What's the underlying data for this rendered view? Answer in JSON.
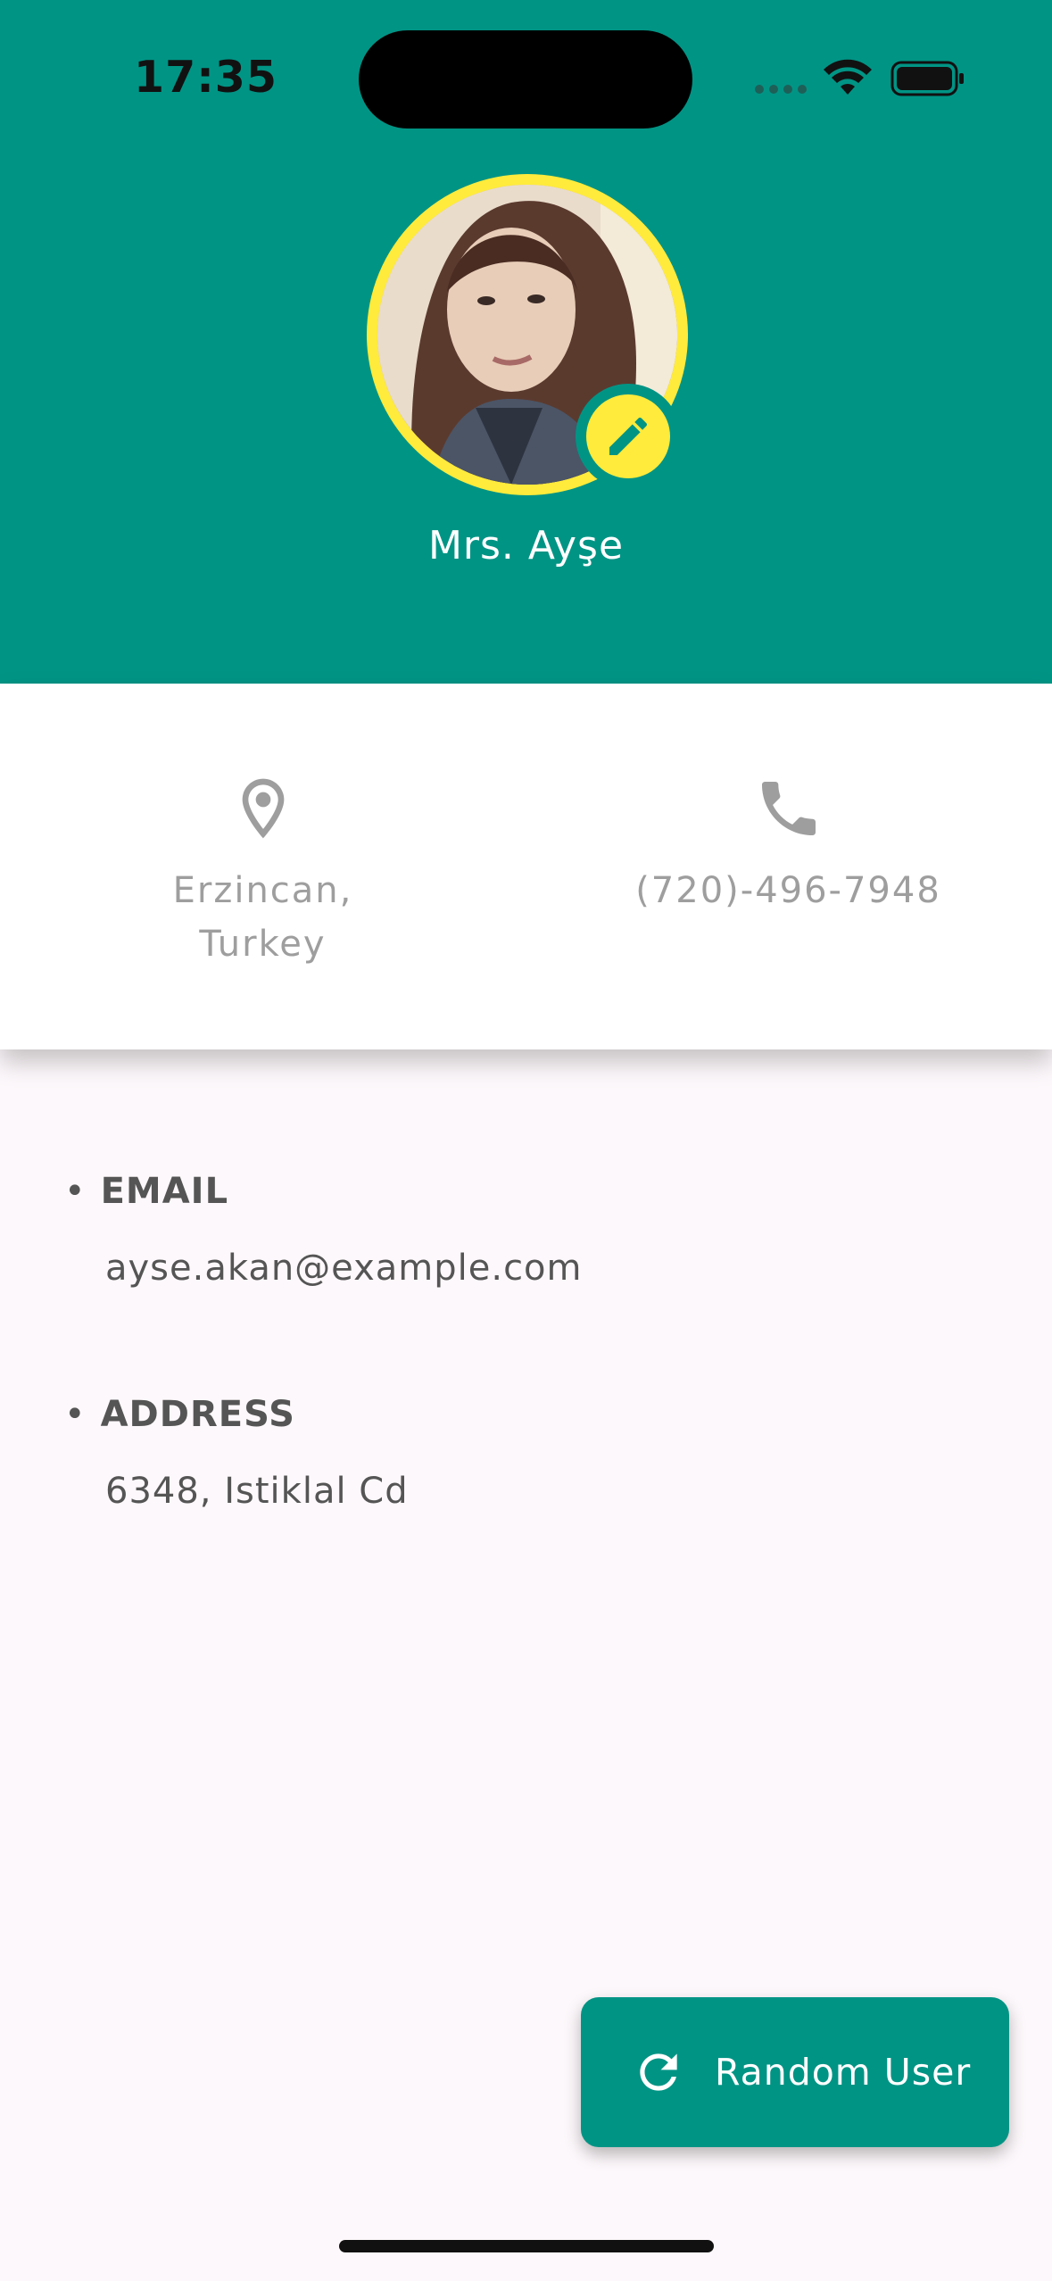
{
  "status_bar": {
    "time": "17:35"
  },
  "profile": {
    "name": "Mrs. Ayşe",
    "avatar_icon": "user-portrait",
    "edit_icon": "pencil-icon"
  },
  "info": {
    "location": "Erzincan, Turkey",
    "location_icon": "location-pin-icon",
    "phone": "(720)-496-7948",
    "phone_icon": "phone-icon"
  },
  "details": {
    "email": {
      "label": "EMAIL",
      "value": "ayse.akan@example.com"
    },
    "address": {
      "label": "ADDRESS",
      "value": "6348, Istiklal Cd"
    }
  },
  "fab": {
    "label": "Random User",
    "icon": "refresh-icon"
  },
  "colors": {
    "primary": "#009485",
    "accent": "#ffeb3b",
    "background": "#fdf8fb",
    "muted_text": "#9e9e9e",
    "body_text": "#555555"
  }
}
